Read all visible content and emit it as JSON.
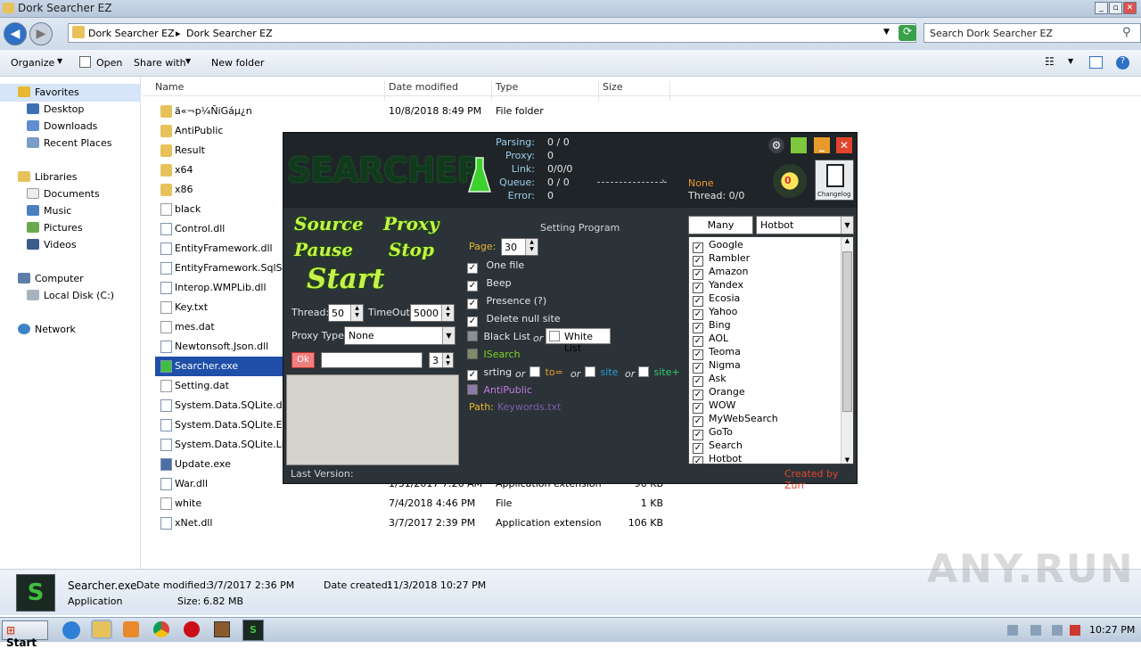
{
  "window": {
    "title": "Dork Searcher EZ",
    "min": "_",
    "max": "▫",
    "close": "✕"
  },
  "address": {
    "crumb1": "Dork Searcher EZ",
    "crumb2": "Dork Searcher EZ",
    "search_placeholder": "Search Dork Searcher EZ"
  },
  "toolbar": {
    "organize": "Organize",
    "open": "Open",
    "share": "Share with",
    "newfolder": "New folder"
  },
  "nav": {
    "favorites": "Favorites",
    "desktop": "Desktop",
    "downloads": "Downloads",
    "recent": "Recent Places",
    "libraries": "Libraries",
    "documents": "Documents",
    "music": "Music",
    "pictures": "Pictures",
    "videos": "Videos",
    "computer": "Computer",
    "localdisk": "Local Disk (C:)",
    "network": "Network"
  },
  "columns": {
    "name": "Name",
    "date": "Date modified",
    "type": "Type",
    "size": "Size"
  },
  "files": [
    {
      "name": "ä«¬p¼ÑiGáµ¿n",
      "date": "10/8/2018 8:49 PM",
      "type": "File folder",
      "size": "",
      "kind": "folder"
    },
    {
      "name": "AntiPublic",
      "date": "",
      "type": "",
      "size": "",
      "kind": "folder"
    },
    {
      "name": "Result",
      "date": "",
      "type": "",
      "size": "",
      "kind": "folder"
    },
    {
      "name": "x64",
      "date": "",
      "type": "",
      "size": "",
      "kind": "folder"
    },
    {
      "name": "x86",
      "date": "",
      "type": "",
      "size": "",
      "kind": "folder"
    },
    {
      "name": "black",
      "date": "",
      "type": "",
      "size": "",
      "kind": "file"
    },
    {
      "name": "Control.dll",
      "date": "",
      "type": "",
      "size": "",
      "kind": "dll"
    },
    {
      "name": "EntityFramework.dll",
      "date": "",
      "type": "",
      "size": "",
      "kind": "dll"
    },
    {
      "name": "EntityFramework.SqlServ",
      "date": "",
      "type": "",
      "size": "",
      "kind": "dll"
    },
    {
      "name": "Interop.WMPLib.dll",
      "date": "",
      "type": "",
      "size": "",
      "kind": "dll"
    },
    {
      "name": "Key.txt",
      "date": "",
      "type": "",
      "size": "",
      "kind": "file"
    },
    {
      "name": "mes.dat",
      "date": "",
      "type": "",
      "size": "",
      "kind": "file"
    },
    {
      "name": "Newtonsoft.Json.dll",
      "date": "",
      "type": "",
      "size": "",
      "kind": "dll"
    },
    {
      "name": "Searcher.exe",
      "date": "",
      "type": "",
      "size": "",
      "kind": "exe"
    },
    {
      "name": "Setting.dat",
      "date": "",
      "type": "",
      "size": "",
      "kind": "file"
    },
    {
      "name": "System.Data.SQLite.dll",
      "date": "",
      "type": "",
      "size": "",
      "kind": "dll"
    },
    {
      "name": "System.Data.SQLite.EF6",
      "date": "",
      "type": "",
      "size": "",
      "kind": "dll"
    },
    {
      "name": "System.Data.SQLite.Linq",
      "date": "",
      "type": "",
      "size": "",
      "kind": "dll"
    },
    {
      "name": "Update.exe",
      "date": "",
      "type": "",
      "size": "",
      "kind": "exe2"
    },
    {
      "name": "War.dll",
      "date": "1/31/2017 7:26 AM",
      "type": "Application extension",
      "size": "90 KB",
      "kind": "dll"
    },
    {
      "name": "white",
      "date": "7/4/2018 4:46 PM",
      "type": "File",
      "size": "1 KB",
      "kind": "file"
    },
    {
      "name": "xNet.dll",
      "date": "3/7/2017 2:39 PM",
      "type": "Application extension",
      "size": "106 KB",
      "kind": "dll"
    }
  ],
  "details": {
    "name": "Searcher.exe",
    "modified_label": "Date modified:",
    "modified": "3/7/2017 2:36 PM",
    "created_label": "Date created:",
    "created": "11/3/2018 10:27 PM",
    "type": "Application",
    "size_label": "Size:",
    "size": "6.82 MB"
  },
  "taskbar": {
    "start": "Start",
    "time": "10:27 PM"
  },
  "watermark": "ANY.RUN",
  "app": {
    "logo": "SEARCHER",
    "stats": [
      {
        "label": "Parsing:",
        "value": "0 / 0"
      },
      {
        "label": "Proxy:",
        "value": "0"
      },
      {
        "label": "Link:",
        "value": "0/0/0"
      },
      {
        "label": "Queue:",
        "value": "0 / 0"
      },
      {
        "label": "Error:",
        "value": "0"
      }
    ],
    "none": "None",
    "thread_status": "Thread:  0/0",
    "bulb_count": "0",
    "changelog": "Changelog",
    "source": "Source",
    "proxy": "Proxy",
    "pause": "Pause",
    "stop": "Stop",
    "start": "Start",
    "thread_label": "Thread:",
    "thread": "50",
    "timeout_label": "TimeOut:",
    "timeout": "5000",
    "proxytype_label": "Proxy Type:",
    "proxytype": "None",
    "ok": "Ok",
    "count": "3",
    "setting_title": "Setting Program",
    "page_label": "Page:",
    "page": "30",
    "one_file": "One file",
    "beep": "Beep",
    "presence": "Presence (?)",
    "delete_null": "Delete null site",
    "blacklist": "Black List",
    "or": "or",
    "whitelist": "White List",
    "isearch": "ISearch",
    "srting": "srting",
    "to": "to=",
    "site": "site",
    "siteplus": "site+",
    "antipublic": "AntiPublic",
    "path_label": "Path:",
    "path": "Keywords.txt",
    "many": "Many",
    "engine_selected": "Hotbot",
    "engines": [
      "Google",
      "Rambler",
      "Amazon",
      "Yandex",
      "Ecosia",
      "Yahoo",
      "Bing",
      "AOL",
      "Teoma",
      "Nigma",
      "Ask",
      "Orange",
      "WOW",
      "MyWebSearch",
      "GoTo",
      "Search",
      "Hotbot"
    ],
    "last_version": "Last Version:",
    "created_by": "Created by Zurr"
  }
}
